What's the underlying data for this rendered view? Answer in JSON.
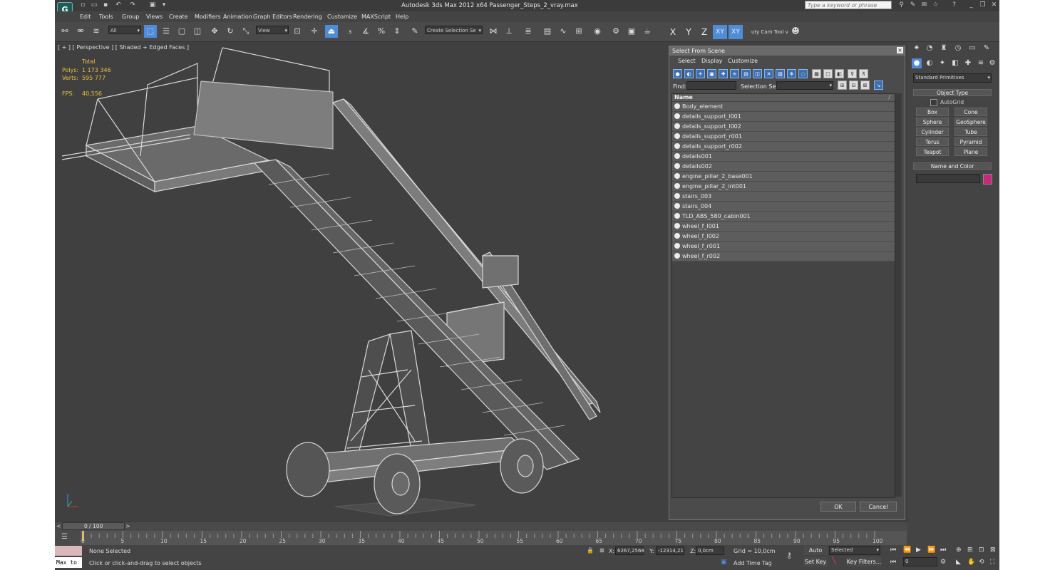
{
  "app": {
    "title": "Autodesk 3ds Max  2012 x64      Passenger_Steps_2_vray.max",
    "logo": "G",
    "search_placeholder": "Type a keyword or phrase"
  },
  "menu": [
    "Edit",
    "Tools",
    "Group",
    "Views",
    "Create",
    "Modifiers",
    "Animation",
    "Graph Editors",
    "Rendering",
    "Customize",
    "MAXScript",
    "Help"
  ],
  "toolbar": {
    "selection_filter": "All",
    "ref_coord": "View",
    "named_selection": "Create Selection Se",
    "cam_tool": "uty Cam Tool v",
    "axis_x": "X",
    "axis_y": "Y",
    "axis_z": "Z",
    "axis_xy": "XY",
    "axis_xy2": "XY"
  },
  "viewport": {
    "label": "[ + ] [ Perspective ] [ Shaded + Edged Faces ]",
    "stats": {
      "total_label": "Total",
      "polys_label": "Polys:",
      "polys_value": "1 173 346",
      "verts_label": "Verts:",
      "verts_value": "595 777",
      "fps_label": "FPS:",
      "fps_value": "40,556"
    }
  },
  "dialog": {
    "title": "Select From Scene",
    "menus": [
      "Select",
      "Display",
      "Customize"
    ],
    "find_label": "Find:",
    "selection_set_label": "Selection Set:",
    "column_name": "Name",
    "objects": [
      "Body_element",
      "details_support_l001",
      "details_support_l002",
      "details_support_r001",
      "details_support_r002",
      "details001",
      "details002",
      "engine_pillar_2_base001",
      "engine_pillar_2_int001",
      "stairs_003",
      "stairs_004",
      "TLD_ABS_580_cabin001",
      "wheel_f_l001",
      "wheel_f_l002",
      "wheel_f_r001",
      "wheel_f_r002"
    ],
    "ok_label": "OK",
    "cancel_label": "Cancel"
  },
  "command_panel": {
    "dropdown": "Standard Primitives",
    "object_type_label": "Object Type",
    "autogrid_label": "AutoGrid",
    "primitives": [
      "Box",
      "Cone",
      "Sphere",
      "GeoSphere",
      "Cylinder",
      "Tube",
      "Torus",
      "Pyramid",
      "Teapot",
      "Plane"
    ],
    "name_color_label": "Name and Color",
    "object_color": "#c8287a"
  },
  "timeline": {
    "frame_counter": "0 / 100",
    "ticks": [
      "0",
      "5",
      "10",
      "15",
      "20",
      "25",
      "30",
      "35",
      "40",
      "45",
      "50",
      "55",
      "60",
      "65",
      "70",
      "75",
      "80",
      "85",
      "90",
      "95",
      "100"
    ]
  },
  "status": {
    "maxscript_label": "Max to",
    "selection_status": "None Selected",
    "prompt": "Click or click-and-drag to select objects",
    "x_label": "X:",
    "x_value": "6267,2568",
    "y_label": "Y:",
    "y_value": "-12314,21",
    "z_label": "Z:",
    "z_value": "0,0cm",
    "grid": "Grid = 10,0cm",
    "add_time_tag": "Add Time Tag",
    "auto_key": "Auto Key",
    "set_key": "Set Key",
    "key_mode": "Selected",
    "key_filters": "Key Filters...",
    "frame_value": "0"
  },
  "colors": {
    "accent": "#4f8bd6",
    "viewport_bg": "#404040",
    "stats_text": "#e8c23a"
  }
}
